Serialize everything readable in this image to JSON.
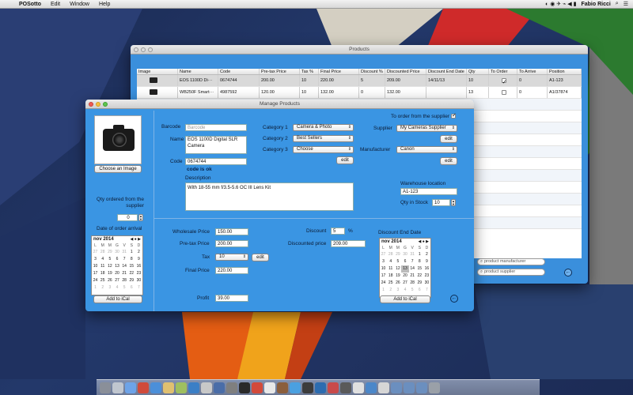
{
  "menubar": {
    "apple": "",
    "app_name": "POSotto",
    "menus": [
      "Edit",
      "Window",
      "Help"
    ],
    "user": "Fabio Ricci"
  },
  "products_window": {
    "title": "Products",
    "columns": [
      "Image",
      "Name",
      "Code",
      "Pre-tax Price",
      "Tax %",
      "Final Price",
      "Discount %",
      "Discounted Price",
      "Discount End Date",
      "Qty",
      "To Order",
      "To Arrive",
      "Position"
    ],
    "rows": [
      {
        "name": "EOS 1100D Di···",
        "code": "0674744",
        "pretax": "200.00",
        "tax": "10",
        "final": "220.00",
        "discount": "5",
        "discounted": "209.00",
        "end_date": "14/11/13",
        "qty": "10",
        "to_order": true,
        "to_arrive": "0",
        "position": "A1-123"
      },
      {
        "name": "WB250F Smart···",
        "code": "4987592",
        "pretax": "120.00",
        "tax": "10",
        "final": "132.00",
        "discount": "0",
        "discounted": "132.00",
        "end_date": "",
        "qty": "13",
        "to_order": false,
        "to_arrive": "0",
        "position": "A1/37874"
      }
    ],
    "search_manufacturer_placeholder": "product manufacturer",
    "search_supplier_placeholder": "product supplier"
  },
  "manage_window": {
    "title": "Manage Products",
    "choose_image": "Choose an Image",
    "barcode_label": "Barcode",
    "barcode_placeholder": "Barcode",
    "name_label": "Name",
    "name_value": "EOS 1100D Digital SLR Camera",
    "code_label": "Code",
    "code_value": "0674744",
    "code_status": "code is ok",
    "category1_label": "Category 1",
    "category1_value": "Camera & Photo",
    "category2_label": "Category 2",
    "category2_value": "Best Sellers",
    "category3_label": "Category 3",
    "category3_value": "Choose",
    "edit_label": "edit",
    "to_order_label": "To order from the supplier",
    "supplier_label": "Supplier",
    "supplier_value": "My Cameras Supplier",
    "manufacturer_label": "Manufacturer",
    "manufacturer_value": "Canon",
    "description_label": "Description",
    "description_value": "With 18-55 mm f/3.5-5.6 OC III Lens Kit",
    "warehouse_label": "Warehouse location",
    "warehouse_value": "A1-123",
    "qty_stock_label": "Qty in Stock",
    "qty_stock_value": "10",
    "qty_ordered_label": "Qty ordered from the supplier",
    "qty_ordered_value": "0",
    "date_arrival_label": "Date of order arrival",
    "wholesale_label": "Wholesale Price",
    "wholesale_value": "150.00",
    "pretax_label": "Pre-tax Price",
    "pretax_value": "200.00",
    "tax_label": "Tax",
    "tax_value": "10",
    "final_label": "Final Price",
    "final_value": "220.00",
    "profit_label": "Profit",
    "profit_value": "39.00",
    "discount_label": "Discount",
    "discount_value": "5",
    "percent": "%",
    "discounted_label": "Discounted price",
    "discounted_value": "209.00",
    "discount_end_label": "Discount End Date",
    "add_ical": "Add to iCal"
  },
  "calendar": {
    "month": "nov 2014",
    "nav": "◀ ● ▶",
    "dow": [
      "L",
      "M",
      "M",
      "G",
      "V",
      "S",
      "D"
    ],
    "weeks": [
      [
        "27",
        "28",
        "29",
        "30",
        "31",
        "1",
        "2"
      ],
      [
        "3",
        "4",
        "5",
        "6",
        "7",
        "8",
        "9"
      ],
      [
        "10",
        "11",
        "12",
        "13",
        "14",
        "15",
        "16"
      ],
      [
        "17",
        "18",
        "19",
        "20",
        "21",
        "22",
        "23"
      ],
      [
        "24",
        "25",
        "26",
        "27",
        "28",
        "29",
        "30"
      ],
      [
        "1",
        "2",
        "3",
        "4",
        "5",
        "6",
        "7"
      ]
    ]
  },
  "colors": {
    "window_blue": "#3a95e3",
    "products_blue": "#3a8fdc"
  }
}
